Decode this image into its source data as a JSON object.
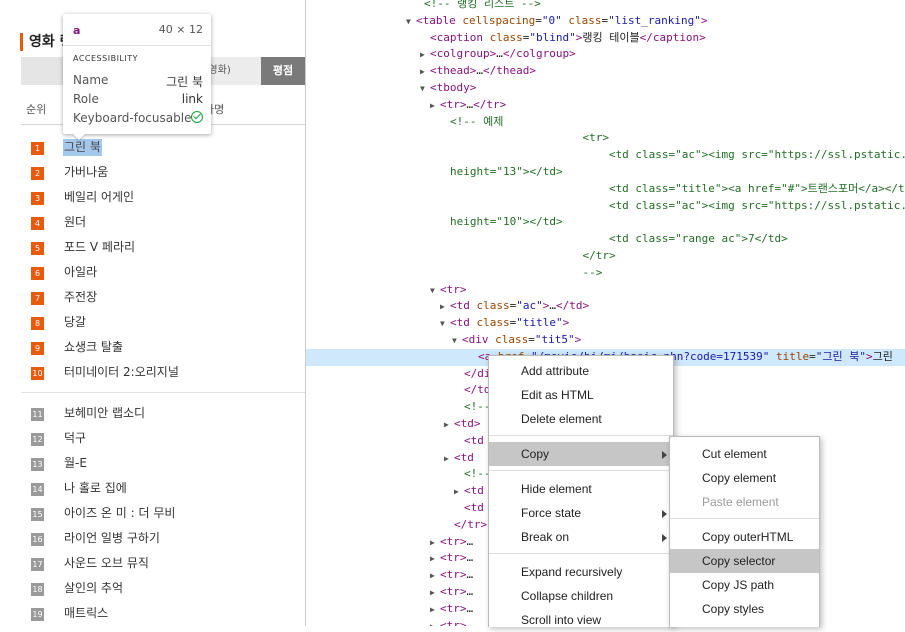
{
  "page": {
    "section_title": "영화 랭",
    "tabs": [
      "",
      "영영화)",
      "평점"
    ],
    "columns": {
      "rank": "순위",
      "title": "화명"
    }
  },
  "rankings": [
    {
      "rank": "1",
      "name": "그린 북"
    },
    {
      "rank": "2",
      "name": "가버나움"
    },
    {
      "rank": "3",
      "name": "베일리 어게인"
    },
    {
      "rank": "4",
      "name": "원더"
    },
    {
      "rank": "5",
      "name": "포드 V 페라리"
    },
    {
      "rank": "6",
      "name": "아일라"
    },
    {
      "rank": "7",
      "name": "주전장"
    },
    {
      "rank": "8",
      "name": "당갈"
    },
    {
      "rank": "9",
      "name": "쇼생크 탈출"
    },
    {
      "rank": "10",
      "name": "터미네이터 2:오리지널"
    },
    {
      "rank": "11",
      "name": "보헤미안 랩소디"
    },
    {
      "rank": "12",
      "name": "덕구"
    },
    {
      "rank": "13",
      "name": "월-E"
    },
    {
      "rank": "14",
      "name": "나 홀로 집에"
    },
    {
      "rank": "15",
      "name": "아이즈 온 미 : 더 무비"
    },
    {
      "rank": "16",
      "name": "라이언 일병 구하기"
    },
    {
      "rank": "17",
      "name": "사운드 오브 뮤직"
    },
    {
      "rank": "18",
      "name": "살인의 추억"
    },
    {
      "rank": "19",
      "name": "매트릭스"
    }
  ],
  "tooltip": {
    "tag": "a",
    "dimensions": "40 × 12",
    "section": "ACCESSIBILITY",
    "name_label": "Name",
    "name_value": "그린 북",
    "role_label": "Role",
    "role_value": "link",
    "focus_label": "Keyboard-focusable"
  },
  "devtools": {
    "lines": [
      {
        "arrow": "",
        "html": "<span class='cmt'>&lt;!-- 랭킹 리스트 --&gt;</span>"
      },
      {
        "arrow": "▼",
        "html": "<span class='tag'>&lt;table</span> <span class='att'>cellspacing</span>=<span class='val'>\"0\"</span> <span class='att'>class</span>=<span class='val'>\"list_ranking\"</span><span class='tag'>&gt;</span>"
      },
      {
        "arrow": "",
        "html": "<span class='tag'>&lt;caption</span> <span class='att'>class</span>=<span class='val'>\"blind\"</span><span class='tag'>&gt;</span>랭킹 테이블<span class='tag'>&lt;/caption&gt;</span>"
      },
      {
        "arrow": "▶",
        "html": "<span class='tag'>&lt;colgroup&gt;</span>…<span class='tag'>&lt;/colgroup&gt;</span>"
      },
      {
        "arrow": "▶",
        "html": "<span class='tag'>&lt;thead&gt;</span>…<span class='tag'>&lt;/thead&gt;</span>"
      },
      {
        "arrow": "▼",
        "html": "<span class='tag'>&lt;tbody&gt;</span>"
      },
      {
        "arrow": "▶",
        "html": "<span class='tag'>&lt;tr&gt;</span>…<span class='tag'>&lt;/tr&gt;</span>"
      },
      {
        "arrow": "",
        "html": "<span class='cmt'>&lt;!-- 예제</span>"
      },
      {
        "arrow": "",
        "html": "<span class='cmt'>                    &lt;tr&gt;</span>"
      },
      {
        "arrow": "",
        "html": "<span class='cmt'>                        &lt;td class=\"ac\"&gt;&lt;img src=\"https://ssl.pstatic.net/</span>"
      },
      {
        "arrow": "",
        "html": "<span class='cmt'>height=\"13\"&gt;&lt;/td&gt;</span>"
      },
      {
        "arrow": "",
        "html": "<span class='cmt'>                        &lt;td class=\"title\"&gt;&lt;a href=\"#\"&gt;트랜스포머&lt;/a&gt;&lt;/td&gt;</span>"
      },
      {
        "arrow": "",
        "html": "<span class='cmt'>                        &lt;td class=\"ac\"&gt;&lt;img src=\"https://ssl.pstatic.net/</span>"
      },
      {
        "arrow": "",
        "html": "<span class='cmt'>height=\"10\"&gt;&lt;/td&gt;</span>"
      },
      {
        "arrow": "",
        "html": "<span class='cmt'>                        &lt;td class=\"range ac\"&gt;7&lt;/td&gt;</span>"
      },
      {
        "arrow": "",
        "html": "<span class='cmt'>                    &lt;/tr&gt;</span>"
      },
      {
        "arrow": "",
        "html": "<span class='cmt'>                    --&gt;</span>"
      },
      {
        "arrow": "▼",
        "html": "<span class='tag'>&lt;tr&gt;</span>"
      },
      {
        "arrow": "▶",
        "html": "<span class='tag'>&lt;td</span> <span class='att'>class</span>=<span class='val'>\"ac\"</span><span class='tag'>&gt;</span>…<span class='tag'>&lt;/td&gt;</span>"
      },
      {
        "arrow": "▼",
        "html": "<span class='tag'>&lt;td</span> <span class='att'>class</span>=<span class='val'>\"title\"</span><span class='tag'>&gt;</span>"
      },
      {
        "arrow": "▼",
        "html": "<span class='tag'>&lt;div</span> <span class='att'>class</span>=<span class='val'>\"tit5\"</span><span class='tag'>&gt;</span>"
      },
      {
        "arrow": "",
        "html": "<span class='tag'>&lt;a</span> <span class='att'>href</span>=<span class='val'>\"/movie/bi/mi/basic.nhn?code=171539\"</span> <span class='att'>title</span>=<span class='val'>\"그린 북\"</span><span class='tag'>&gt;</span>그린"
      },
      {
        "arrow": "",
        "html": "<span class='tag'>&lt;/div&gt;</span>"
      },
      {
        "arrow": "",
        "html": "<span class='tag'>&lt;/td&gt;</span>"
      },
      {
        "arrow": "",
        "html": "<span class='cmt'>&lt;!--</span>"
      },
      {
        "arrow": "▶",
        "html": "<span class='tag'>&lt;td&gt;</span>"
      },
      {
        "arrow": "",
        "html": "<span class='tag'>&lt;td</span>"
      },
      {
        "arrow": "▶",
        "html": "<span class='tag'>&lt;td</span>"
      },
      {
        "arrow": "",
        "html": "<span class='cmt'>&lt;!--</span>"
      },
      {
        "arrow": "▶",
        "html": "<span class='tag'>&lt;td</span>"
      },
      {
        "arrow": "",
        "html": "<span class='tag'>&lt;td</span>"
      },
      {
        "arrow": "",
        "html": "<span class='tag'>&lt;/tr&gt;</span>"
      },
      {
        "arrow": "▶",
        "html": "<span class='tag'>&lt;tr&gt;</span>…"
      },
      {
        "arrow": "▶",
        "html": "<span class='tag'>&lt;tr&gt;</span>…"
      },
      {
        "arrow": "▶",
        "html": "<span class='tag'>&lt;tr&gt;</span>…"
      },
      {
        "arrow": "▶",
        "html": "<span class='tag'>&lt;tr&gt;</span>…"
      },
      {
        "arrow": "▶",
        "html": "<span class='tag'>&lt;tr&gt;</span>…"
      },
      {
        "arrow": "▶",
        "html": "<span class='tag'>&lt;tr&gt;</span>…"
      }
    ]
  },
  "context_menu": {
    "items": [
      "Add attribute",
      "Edit as HTML",
      "Delete element",
      "Copy",
      "Hide element",
      "Force state",
      "Break on",
      "Expand recursively",
      "Collapse children",
      "Scroll into view"
    ],
    "submenu": [
      "Cut element",
      "Copy element",
      "Paste element",
      "Copy outerHTML",
      "Copy selector",
      "Copy JS path",
      "Copy styles"
    ]
  },
  "colors": {
    "accent": "#e85a0c",
    "selection": "#cfe8fc",
    "menu_active": "#c6c6c6"
  }
}
